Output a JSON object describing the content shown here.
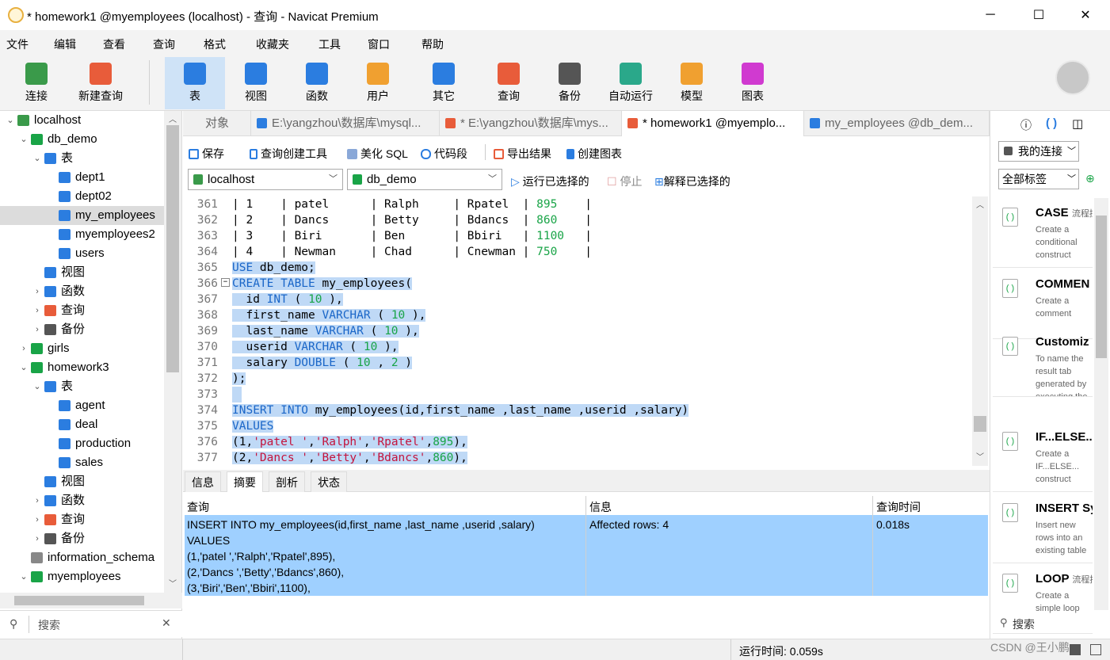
{
  "window": {
    "title": "* homework1 @myemployees (localhost) - 查询 - Navicat Premium",
    "minimize": "─",
    "maximize": "☐",
    "close": "✕"
  },
  "menu": [
    "文件",
    "编辑",
    "查看",
    "查询",
    "格式",
    "收藏夹",
    "工具",
    "窗口",
    "帮助"
  ],
  "toolbar": [
    {
      "label": "连接",
      "icon": "connect-icon",
      "color": "#3a9a4a"
    },
    {
      "label": "新建查询",
      "icon": "new-query-icon",
      "color": "#e85c3a"
    },
    {
      "label": "表",
      "icon": "table-icon",
      "color": "#2b7de0"
    },
    {
      "label": "视图",
      "icon": "view-icon",
      "color": "#2b7de0"
    },
    {
      "label": "函数",
      "icon": "function-icon",
      "color": "#2b7de0"
    },
    {
      "label": "用户",
      "icon": "user-icon",
      "color": "#f0a030"
    },
    {
      "label": "其它",
      "icon": "tools-icon",
      "color": "#2b7de0"
    },
    {
      "label": "查询",
      "icon": "query-icon",
      "color": "#e85c3a"
    },
    {
      "label": "备份",
      "icon": "backup-icon",
      "color": "#555555"
    },
    {
      "label": "自动运行",
      "icon": "robot-icon",
      "color": "#2aa88a"
    },
    {
      "label": "模型",
      "icon": "model-icon",
      "color": "#f0a030"
    },
    {
      "label": "图表",
      "icon": "chart-icon",
      "color": "#d03ad0"
    }
  ],
  "tree": [
    {
      "label": "localhost",
      "level": 0,
      "arrow": "⌄",
      "icon": "server",
      "color": "#3a9a4a"
    },
    {
      "label": "db_demo",
      "level": 1,
      "arrow": "⌄",
      "icon": "db",
      "color": "#19a447"
    },
    {
      "label": "表",
      "level": 2,
      "arrow": "⌄",
      "icon": "table",
      "color": "#2b7de0"
    },
    {
      "label": "dept1",
      "level": 3,
      "arrow": "",
      "icon": "table",
      "color": "#2b7de0"
    },
    {
      "label": "dept02",
      "level": 3,
      "arrow": "",
      "icon": "table",
      "color": "#2b7de0"
    },
    {
      "label": "my_employees",
      "level": 3,
      "arrow": "",
      "icon": "table",
      "color": "#2b7de0",
      "selected": true
    },
    {
      "label": "myemployees2",
      "level": 3,
      "arrow": "",
      "icon": "table",
      "color": "#2b7de0"
    },
    {
      "label": "users",
      "level": 3,
      "arrow": "",
      "icon": "table",
      "color": "#2b7de0"
    },
    {
      "label": "视图",
      "level": 2,
      "arrow": "",
      "icon": "view",
      "color": "#2b7de0"
    },
    {
      "label": "函数",
      "level": 2,
      "arrow": "›",
      "icon": "func",
      "color": "#2b7de0"
    },
    {
      "label": "查询",
      "level": 2,
      "arrow": "›",
      "icon": "query",
      "color": "#e85c3a"
    },
    {
      "label": "备份",
      "level": 2,
      "arrow": "›",
      "icon": "backup",
      "color": "#555555"
    },
    {
      "label": "girls",
      "level": 1,
      "arrow": "›",
      "icon": "db",
      "color": "#19a447"
    },
    {
      "label": "homework3",
      "level": 1,
      "arrow": "⌄",
      "icon": "db",
      "color": "#19a447"
    },
    {
      "label": "表",
      "level": 2,
      "arrow": "⌄",
      "icon": "table",
      "color": "#2b7de0"
    },
    {
      "label": "agent",
      "level": 3,
      "arrow": "",
      "icon": "table",
      "color": "#2b7de0"
    },
    {
      "label": "deal",
      "level": 3,
      "arrow": "",
      "icon": "table",
      "color": "#2b7de0"
    },
    {
      "label": "production",
      "level": 3,
      "arrow": "",
      "icon": "table",
      "color": "#2b7de0"
    },
    {
      "label": "sales",
      "level": 3,
      "arrow": "",
      "icon": "table",
      "color": "#2b7de0"
    },
    {
      "label": "视图",
      "level": 2,
      "arrow": "",
      "icon": "view",
      "color": "#2b7de0"
    },
    {
      "label": "函数",
      "level": 2,
      "arrow": "›",
      "icon": "func",
      "color": "#2b7de0"
    },
    {
      "label": "查询",
      "level": 2,
      "arrow": "›",
      "icon": "query",
      "color": "#e85c3a"
    },
    {
      "label": "备份",
      "level": 2,
      "arrow": "›",
      "icon": "backup",
      "color": "#555555"
    },
    {
      "label": "information_schema",
      "level": 1,
      "arrow": "",
      "icon": "db",
      "color": "#888888"
    },
    {
      "label": "myemployees",
      "level": 1,
      "arrow": "⌄",
      "icon": "db",
      "color": "#19a447"
    }
  ],
  "left_search": {
    "placeholder": "搜索",
    "icon": "search-icon",
    "clear": "✕"
  },
  "tabs": [
    {
      "label": "对象",
      "active": false
    },
    {
      "label": "E:\\yangzhou\\数据库\\mysql...",
      "active": false
    },
    {
      "label": "* E:\\yangzhou\\数据库\\mys...",
      "active": false
    },
    {
      "label": "* homework1 @myemplo...",
      "active": true
    },
    {
      "label": "my_employees @db_dem...",
      "active": false
    }
  ],
  "query_toolbar": {
    "save": "保存",
    "builder": "查询创建工具",
    "beautify": "美化 SQL",
    "snippet": "代码段",
    "export": "导出结果",
    "create_chart": "创建图表",
    "run_selected": "运行已选择的",
    "stop": "停止",
    "explain": "解释已选择的"
  },
  "connection_select": "localhost",
  "database_select": "db_demo",
  "editor_lines": [
    {
      "n": "361",
      "t": [
        [
          "| 1    | patel      | Ralph     | Rpatel  | ",
          ""
        ],
        [
          "895",
          "num"
        ],
        [
          "    |",
          ""
        ]
      ],
      "hl": false
    },
    {
      "n": "362",
      "t": [
        [
          "| 2    | Dancs      | Betty     | Bdancs  | ",
          ""
        ],
        [
          "860",
          "num"
        ],
        [
          "    |",
          ""
        ]
      ],
      "hl": false
    },
    {
      "n": "363",
      "t": [
        [
          "| 3    | Biri       | Ben       | Bbiri   | ",
          ""
        ],
        [
          "1100",
          "num"
        ],
        [
          "   |",
          ""
        ]
      ],
      "hl": false
    },
    {
      "n": "364",
      "t": [
        [
          "| 4    | Newman     | Chad      | Cnewman | ",
          ""
        ],
        [
          "750",
          "num"
        ],
        [
          "    |",
          ""
        ]
      ],
      "hl": false
    },
    {
      "n": "365",
      "t": [
        [
          "USE",
          "kw"
        ],
        [
          " db_demo;",
          ""
        ]
      ],
      "hl": true
    },
    {
      "n": "366",
      "t": [
        [
          "CREATE TABLE",
          "kw"
        ],
        [
          " my_employees(",
          ""
        ]
      ],
      "hl": true
    },
    {
      "n": "367",
      "t": [
        [
          "  id ",
          ""
        ],
        [
          "INT",
          "kw"
        ],
        [
          " ( ",
          ""
        ],
        [
          "10",
          "num"
        ],
        [
          " ),",
          ""
        ]
      ],
      "hl": true
    },
    {
      "n": "368",
      "t": [
        [
          "  first_name ",
          ""
        ],
        [
          "VARCHAR",
          "kw"
        ],
        [
          " ( ",
          ""
        ],
        [
          "10",
          "num"
        ],
        [
          " ),",
          ""
        ]
      ],
      "hl": true
    },
    {
      "n": "369",
      "t": [
        [
          "  last_name ",
          ""
        ],
        [
          "VARCHAR",
          "kw"
        ],
        [
          " ( ",
          ""
        ],
        [
          "10",
          "num"
        ],
        [
          " ),",
          ""
        ]
      ],
      "hl": true
    },
    {
      "n": "370",
      "t": [
        [
          "  userid ",
          ""
        ],
        [
          "VARCHAR",
          "kw"
        ],
        [
          " ( ",
          ""
        ],
        [
          "10",
          "num"
        ],
        [
          " ),",
          ""
        ]
      ],
      "hl": true
    },
    {
      "n": "371",
      "t": [
        [
          "  salary ",
          ""
        ],
        [
          "DOUBLE",
          "kw"
        ],
        [
          " ( ",
          ""
        ],
        [
          "10",
          "num"
        ],
        [
          " , ",
          ""
        ],
        [
          "2",
          "num"
        ],
        [
          " )",
          ""
        ]
      ],
      "hl": true
    },
    {
      "n": "372",
      "t": [
        [
          ");",
          ""
        ]
      ],
      "hl": true
    },
    {
      "n": "373",
      "t": [
        [
          "",
          ""
        ]
      ],
      "hl": true
    },
    {
      "n": "374",
      "t": [
        [
          "INSERT INTO",
          "kw"
        ],
        [
          " my_employees(id,first_name ,last_name ,userid ,salary)",
          ""
        ]
      ],
      "hl": true
    },
    {
      "n": "375",
      "t": [
        [
          "VALUES",
          "kw"
        ]
      ],
      "hl": true
    },
    {
      "n": "376",
      "t": [
        [
          "(1,",
          ""
        ],
        [
          "'patel '",
          "str"
        ],
        [
          ",",
          ""
        ],
        [
          "'Ralph'",
          "str"
        ],
        [
          ",",
          ""
        ],
        [
          "'Rpatel'",
          "str"
        ],
        [
          ",",
          ""
        ],
        [
          "895",
          "num"
        ],
        [
          "),",
          ""
        ]
      ],
      "hl": true
    },
    {
      "n": "377",
      "t": [
        [
          "(2,",
          ""
        ],
        [
          "'Dancs '",
          "str"
        ],
        [
          ",",
          ""
        ],
        [
          "'Betty'",
          "str"
        ],
        [
          ",",
          ""
        ],
        [
          "'Bdancs'",
          "str"
        ],
        [
          ",",
          ""
        ],
        [
          "860",
          "num"
        ],
        [
          "),",
          ""
        ]
      ],
      "hl": true
    }
  ],
  "result_tabs": [
    "信息",
    "摘要",
    "剖析",
    "状态"
  ],
  "result_active": "摘要",
  "result_headers": [
    "查询",
    "信息",
    "查询时间"
  ],
  "result_row": {
    "query": "INSERT INTO my_employees(id,first_name ,last_name ,userid ,salary)\nVALUES\n(1,'patel ','Ralph','Rpatel',895),\n(2,'Dancs ','Betty','Bdancs',860),\n(3,'Biri','Ben','Bbiri',1100),",
    "info": "Affected rows: 4",
    "time": "0.018s"
  },
  "status": {
    "runtime": "运行时间: 0.059s",
    "watermark": "CSDN @王小鹏"
  },
  "right_panel": {
    "my_connections": "我的连接",
    "all_tags": "全部标签",
    "search": "搜索",
    "snippets": [
      {
        "title": "CASE",
        "tag": "流程控",
        "desc": "Create a conditional construct"
      },
      {
        "title": "COMMEN",
        "tag": "",
        "desc": "Create a comment"
      },
      {
        "title": "Customiz",
        "tag": "",
        "desc": "To name the result tab generated by executing the statement."
      },
      {
        "title": "IF...ELSE...",
        "tag": "",
        "desc": "Create a IF...ELSE... construct"
      },
      {
        "title": "INSERT Sy",
        "tag": "",
        "desc": "Insert new rows into an existing table"
      },
      {
        "title": "LOOP",
        "tag": "流程控",
        "desc": "Create a simple loop"
      }
    ]
  }
}
